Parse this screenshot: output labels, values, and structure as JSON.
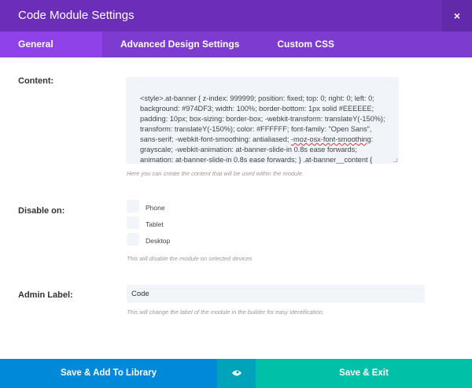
{
  "header": {
    "title": "Code Module Settings",
    "close": "×"
  },
  "tabs": [
    "General Settings",
    "Advanced Design Settings",
    "Custom CSS"
  ],
  "content": {
    "label": "Content:",
    "text_before": "<style>.at-banner { z-index: 999999; position: fixed; top: 0; right: 0; left: 0; background: #974DF3; width: 100%; border-bottom: 1px solid #EEEEEE; padding: 10px; box-sizing: border-box; -webkit-transform: translateY(-150%); transform: translateY(-150%); color: #FFFFFF; font-family: \"Open Sans\", sans-serif; -webkit-font-smoothing: antialiased; ",
    "text_squiggle": "-moz-osx-font-smoothing",
    "text_after": ": grayscale; -webkit-animation: at-banner-slide-in 0.8s ease forwards; animation: at-banner-slide-in 0.8s ease forwards; } .at-banner__content { display: -webkit-box; display: -ms-flexbox; display: flex; -webkit-box-align: center; -ms-flex-align:",
    "help": "Here you can create the content that will be used within the module."
  },
  "disable": {
    "label": "Disable on:",
    "options": [
      "Phone",
      "Tablet",
      "Desktop"
    ],
    "help": "This will disable the module on selected devices"
  },
  "admin": {
    "label": "Admin Label:",
    "value": "Code",
    "help": "This will change the label of the module in the builder for easy identification."
  },
  "footer": {
    "library": "Save & Add To Library",
    "exit": "Save & Exit"
  }
}
